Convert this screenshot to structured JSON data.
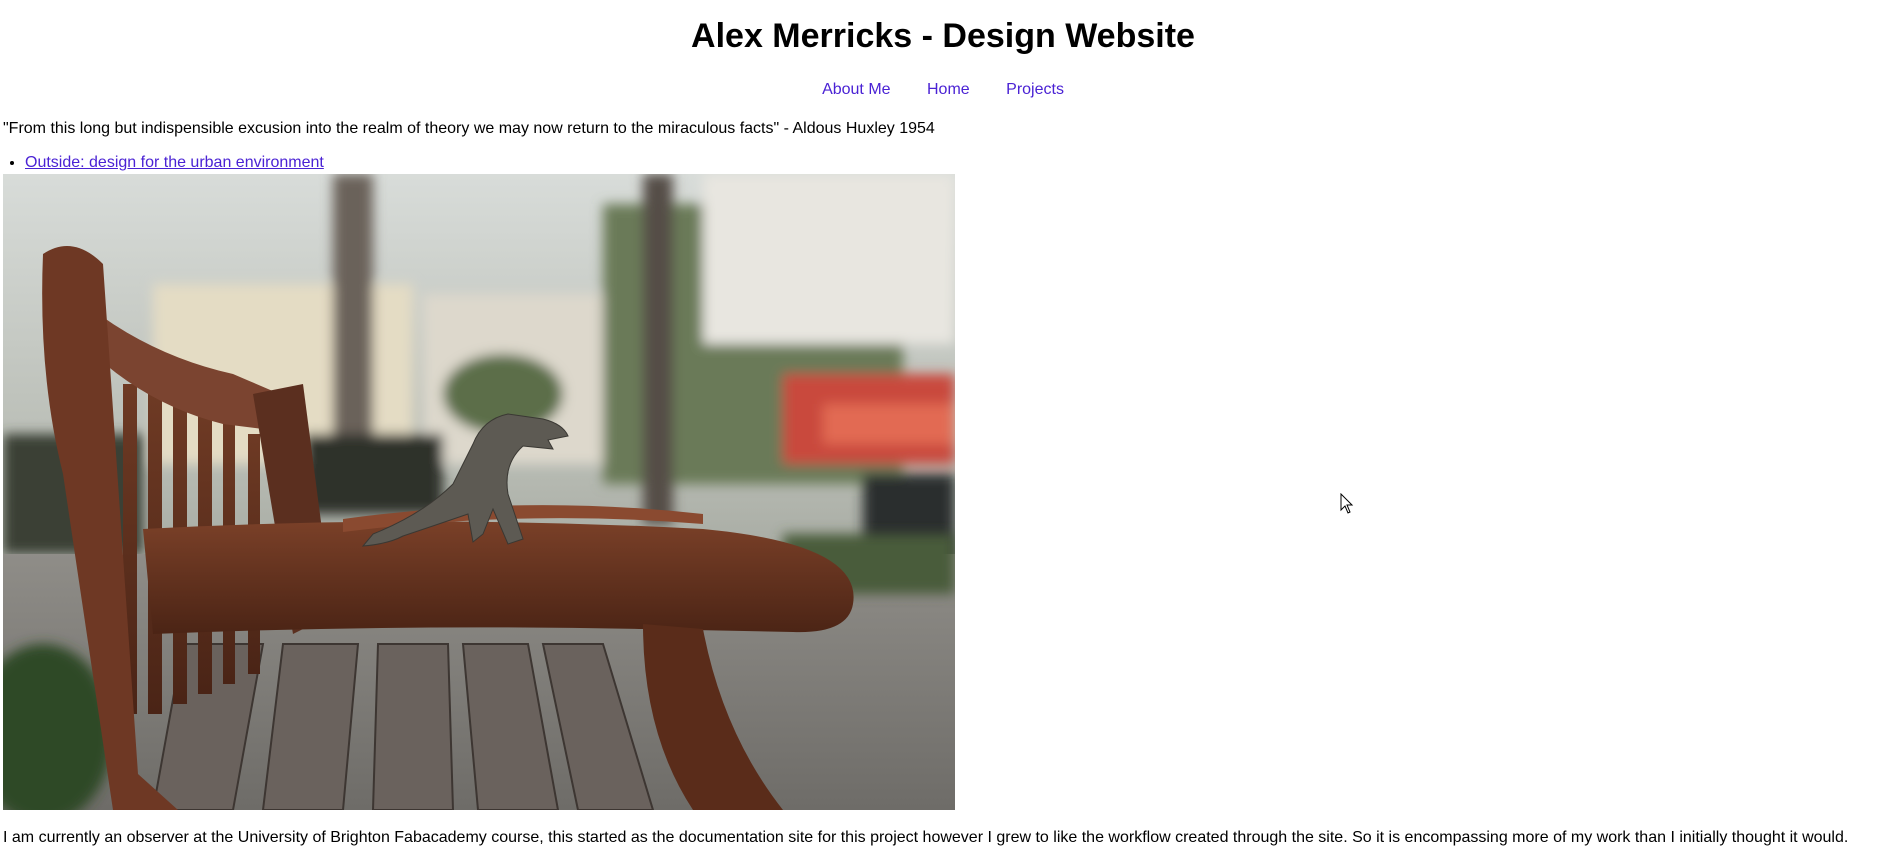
{
  "header": {
    "title": "Alex Merricks - Design Website"
  },
  "nav": {
    "items": [
      {
        "label": "About Me"
      },
      {
        "label": "Home"
      },
      {
        "label": "Projects"
      }
    ]
  },
  "main": {
    "quote": "\"From this long but indispensible excusion into the realm of theory we may now return to the miraculous facts\" - Aldous Huxley 1954",
    "projects": [
      {
        "label": "Outside: design for the urban environment"
      }
    ],
    "intro": "I am currently an observer at the University of Brighton Fabacademy course, this started as the documentation site for this project however I grew to like the workflow created through the site. So it is encompassing more of my work than I initially thought it would."
  },
  "colors": {
    "link": "#4a22d4",
    "text": "#000000",
    "background": "#ffffff"
  }
}
